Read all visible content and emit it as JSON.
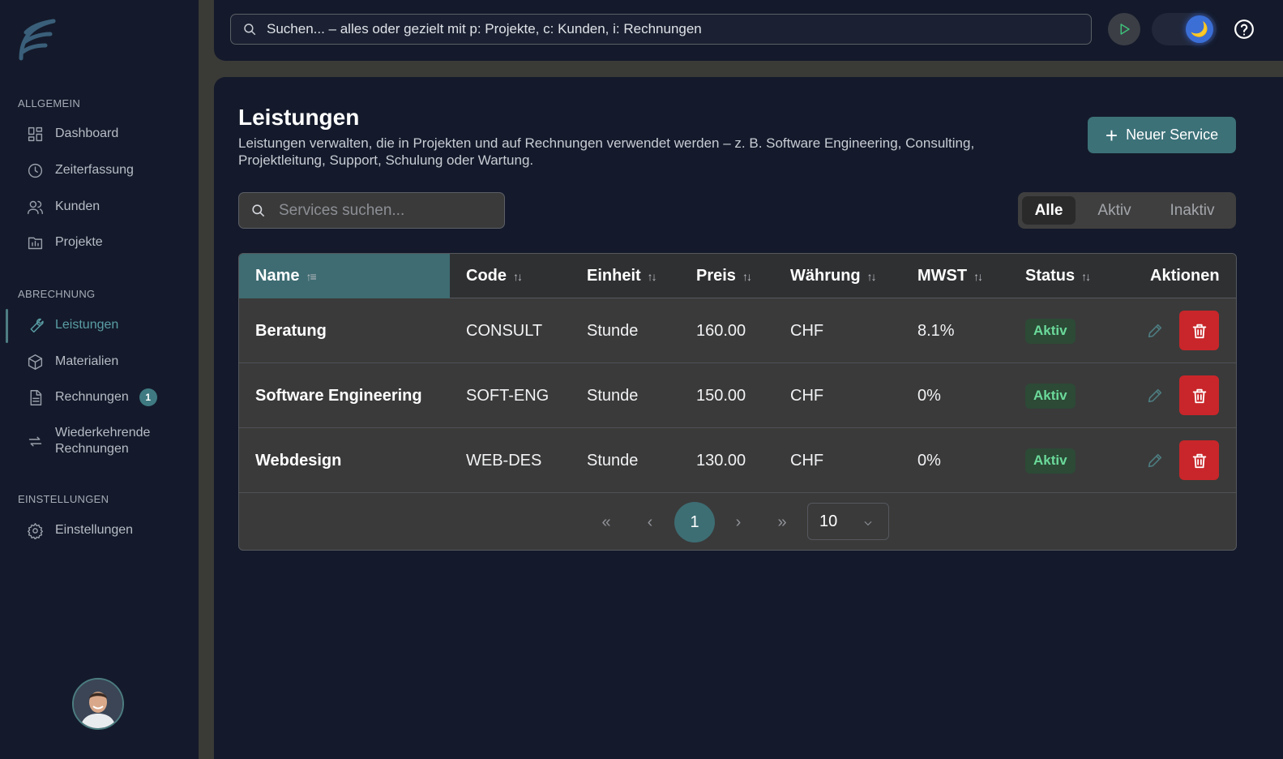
{
  "sidebar": {
    "sections": {
      "general": "ALLGEMEIN",
      "billing": "ABRECHNUNG",
      "settings": "EINSTELLUNGEN"
    },
    "items": {
      "dashboard": "Dashboard",
      "time": "Zeiterfassung",
      "customers": "Kunden",
      "projects": "Projekte",
      "services": "Leistungen",
      "materials": "Materialien",
      "invoices": "Rechnungen",
      "invoices_badge": "1",
      "recurring_line1": "Wiederkehrende",
      "recurring_line2": "Rechnungen",
      "settings": "Einstellungen"
    }
  },
  "topbar": {
    "search_placeholder": "Suchen... – alles oder gezielt mit p: Projekte, c: Kunden, i: Rechnungen",
    "theme_icon": "🌙"
  },
  "page": {
    "title": "Leistungen",
    "subtitle": "Leistungen verwalten, die in Projekten und auf Rechnungen verwendet werden – z. B. Software Engineering, Consulting, Projektleitung, Support, Schulung oder Wartung.",
    "new_button": "Neuer Service",
    "search_placeholder": "Services suchen...",
    "filters": [
      "Alle",
      "Aktiv",
      "Inaktiv"
    ]
  },
  "table": {
    "headers": {
      "name": "Name",
      "code": "Code",
      "unit": "Einheit",
      "price": "Preis",
      "currency": "Währung",
      "vat": "MWST",
      "status": "Status",
      "actions": "Aktionen"
    },
    "rows": [
      {
        "name": "Beratung",
        "code": "CONSULT",
        "unit": "Stunde",
        "price": "160.00",
        "currency": "CHF",
        "vat": "8.1%",
        "status": "Aktiv"
      },
      {
        "name": "Software Engineering",
        "code": "SOFT-ENG",
        "unit": "Stunde",
        "price": "150.00",
        "currency": "CHF",
        "vat": "0%",
        "status": "Aktiv"
      },
      {
        "name": "Webdesign",
        "code": "WEB-DES",
        "unit": "Stunde",
        "price": "130.00",
        "currency": "CHF",
        "vat": "0%",
        "status": "Aktiv"
      }
    ]
  },
  "pagination": {
    "first": "«",
    "prev": "‹",
    "current": "1",
    "next": "›",
    "last": "»",
    "page_size": "10"
  },
  "colors": {
    "accent": "#3c7178",
    "danger": "#c8262a",
    "status_active": "#6bd99a",
    "sidebar_bg": "#141a2b"
  }
}
